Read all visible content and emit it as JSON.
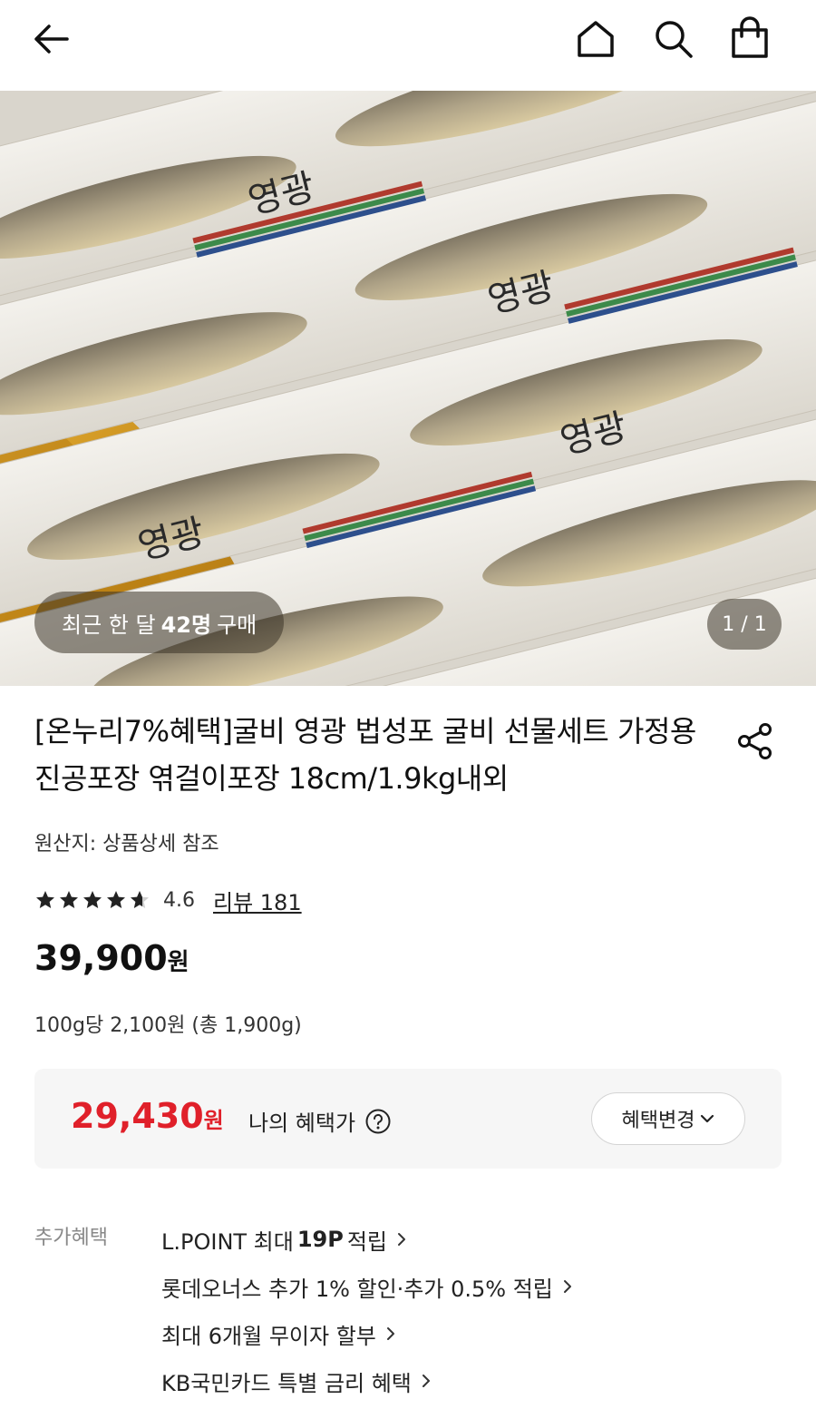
{
  "header": {
    "back_icon": "arrow-left-icon",
    "home_icon": "home-icon",
    "search_icon": "search-icon",
    "bag_icon": "shopping-bag-icon"
  },
  "hero": {
    "purchase_prefix": "최근 한 달",
    "purchase_count": "42명",
    "purchase_suffix": "구매",
    "pager": "1 / 1",
    "package_text": "영광"
  },
  "product": {
    "title": "[온누리7%혜택]굴비 영광 법성포 굴비 선물세트 가정용 진공포장 엮걸이포장 18cm/1.9kg내외",
    "origin": "원산지: 상품상세 참조",
    "rating_value": "4.6",
    "stars": 4.6,
    "review_link": "리뷰 181",
    "price": "39,900",
    "price_unit": "원",
    "unit_price": "100g당 2,100원 (총 1,900g)"
  },
  "benefit": {
    "price": "29,430",
    "price_unit": "원",
    "label": "나의 혜택가",
    "change_button": "혜택변경",
    "accent_color": "#e0202a"
  },
  "extra": {
    "label": "추가혜택",
    "items": [
      {
        "pre": "L.POINT 최대",
        "bold": "19P",
        "post": "적립"
      },
      {
        "pre": "롯데오너스 추가 1% 할인·추가 0.5% 적립",
        "bold": "",
        "post": ""
      },
      {
        "pre": "최대 6개월 무이자 할부",
        "bold": "",
        "post": ""
      },
      {
        "pre": "KB국민카드 특별 금리 혜택",
        "bold": "",
        "post": ""
      }
    ]
  }
}
